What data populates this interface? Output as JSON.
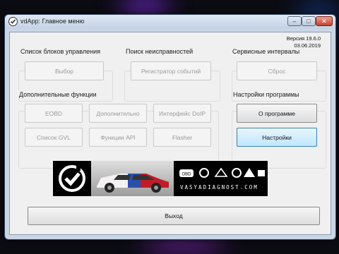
{
  "window": {
    "title": "vdApp: Главное меню",
    "controls": {
      "minimize": "–",
      "maximize": "□",
      "close": "✕"
    }
  },
  "version": {
    "label": "Версия 19.6.0",
    "date": "03.06.2019"
  },
  "groups": {
    "control_units": {
      "title": "Список блоков управления",
      "select_button": "Выбор"
    },
    "fault_search": {
      "title": "Поиск неисправностей",
      "event_recorder_button": "Регистратор событий"
    },
    "service_intervals": {
      "title": "Сервисные интервалы",
      "reset_button": "Сброс"
    },
    "additional": {
      "title": "Дополнительные функции",
      "buttons": [
        "EOBD",
        "Дополнительно",
        "Интерфейс DoIP",
        "Список GVL",
        "Функции API",
        "Flasher"
      ]
    },
    "program_settings": {
      "title": "Настройки программы",
      "about_button": "О программе",
      "settings_button": "Настройки"
    }
  },
  "banner": {
    "url": "VASYADIAGNOST.COM",
    "logo_text": "OBD"
  },
  "exit_button": "Выход",
  "colors": {
    "window_frame": "#c9d6e6",
    "client_bg": "#f0f0f0",
    "close_button": "#c4412d",
    "focused_button": "#bee6fd",
    "car_red": "#c01c28",
    "car_blue": "#2b4fa8"
  }
}
